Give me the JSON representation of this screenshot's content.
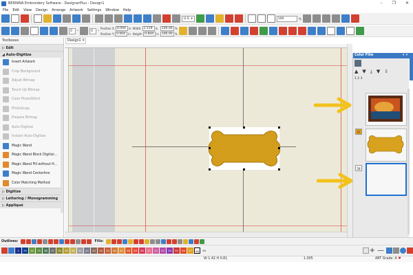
{
  "window": {
    "title": "BERNINA Embroidery Software - DesignerPlus - Design1",
    "controls": [
      "–",
      "❐",
      "✕"
    ]
  },
  "menu": [
    "File",
    "Edit",
    "View",
    "Design",
    "Arrange",
    "Artwork",
    "Settings",
    "Window",
    "Help"
  ],
  "toolbar": {
    "position_x_label": "Position X:",
    "position_y_label": "Position Y:",
    "position_x": "0.004",
    "position_y": "0.004",
    "width_label": "Width:",
    "height_label": "Height:",
    "width": "1.519",
    "height": "0.844",
    "unit": "in",
    "width_pct": "100.00",
    "height_pct": "100.00",
    "pct_unit": "%",
    "hoop_region": "U.S.",
    "zoom_value": "100",
    "zoom_unit": "%",
    "rotate_value": "0",
    "skew_value": "0",
    "degree_unit": "°"
  },
  "toolboxes": {
    "title": "Toolboxes",
    "sections": {
      "edit": "Edit",
      "auto_digitize": "Auto-Digitize",
      "digitize": "Digitize",
      "lettering": "Lettering / Monogramming",
      "applique": "Appliqué"
    },
    "items": [
      {
        "label": "Insert Artwork",
        "enabled": true
      },
      {
        "label": "Crop Background",
        "enabled": false
      },
      {
        "label": "Adjust Bitmap",
        "enabled": false
      },
      {
        "label": "Touch Up Bitmap",
        "enabled": false
      },
      {
        "label": "Color PhotoStitch",
        "enabled": false
      },
      {
        "label": "PhotoSnap",
        "enabled": false
      },
      {
        "label": "Prepare Bitmap",
        "enabled": false
      },
      {
        "label": "Auto-Digitize",
        "enabled": false
      },
      {
        "label": "Instant Auto-Digitize",
        "enabled": false
      },
      {
        "label": "Magic Wand",
        "enabled": true
      },
      {
        "label": "Magic Wand Block Digitizi...",
        "enabled": true
      },
      {
        "label": "Magic Wand Fill without H...",
        "enabled": true
      },
      {
        "label": "Magic Wand Centerline",
        "enabled": true
      },
      {
        "label": "Color Matching Method",
        "enabled": true
      }
    ]
  },
  "document": {
    "tab_label": "Design1"
  },
  "color_film": {
    "title": "Color Film",
    "side_tab": "Color Film",
    "order_label": "1 2 3",
    "slots": [
      {
        "badge": "",
        "content": "artwork-thumbnail",
        "selected": false
      },
      {
        "badge": "57",
        "content": "bone-thumbnail",
        "selected": false
      },
      {
        "badge": "58",
        "content": "empty",
        "selected": true
      }
    ]
  },
  "outlines_bar": {
    "outlines_label": "Outlines:",
    "fills_label": "Fills:"
  },
  "color_bar": {
    "swatches": [
      {
        "n": "1",
        "color": "#1c2f8f"
      },
      {
        "n": "33",
        "color": "#0f3f8f"
      },
      {
        "n": "34",
        "color": "#6a9a3a"
      },
      {
        "n": "35",
        "color": "#5a8a40"
      },
      {
        "n": "36",
        "color": "#4f7a5a"
      },
      {
        "n": "37",
        "color": "#6d6d6d"
      },
      {
        "n": "38",
        "color": "#8a8a2a"
      },
      {
        "n": "39",
        "color": "#b7a03a"
      },
      {
        "n": "40",
        "color": "#c4b45a"
      },
      {
        "n": "41",
        "color": "#a0a0a0"
      },
      {
        "n": "42",
        "color": "#7b7b8f"
      },
      {
        "n": "43",
        "color": "#8a6a5a"
      },
      {
        "n": "44",
        "color": "#b05a40"
      },
      {
        "n": "45",
        "color": "#c4603a"
      },
      {
        "n": "46",
        "color": "#d07a3a"
      },
      {
        "n": "47",
        "color": "#e0903a"
      },
      {
        "n": "48",
        "color": "#e05a2a"
      },
      {
        "n": "49",
        "color": "#e84a3a"
      },
      {
        "n": "50",
        "color": "#d83a5a"
      },
      {
        "n": "51",
        "color": "#e8708a"
      },
      {
        "n": "52",
        "color": "#d05aa0"
      },
      {
        "n": "53",
        "color": "#b04aa8"
      },
      {
        "n": "54",
        "color": "#8a3ab0"
      },
      {
        "n": "55",
        "color": "#c83a3a"
      },
      {
        "n": "56",
        "color": "#e04a2a"
      },
      {
        "n": "57",
        "color": "#e0a020"
      },
      {
        "n": "58",
        "color": "#ffffff",
        "selected": true
      },
      {
        "n": "59",
        "color": "#f0f0f0",
        "plain": true
      }
    ]
  },
  "status": {
    "coords": "W 1.42 H 0.81",
    "zoom": "1.005",
    "grade": "ART Grade: A"
  },
  "colors": {
    "accent_blue": "#3a78c3",
    "bone_fill": "#d8a21e",
    "bone_stroke": "#a77510",
    "annotation_arrow": "#f2c21d"
  }
}
